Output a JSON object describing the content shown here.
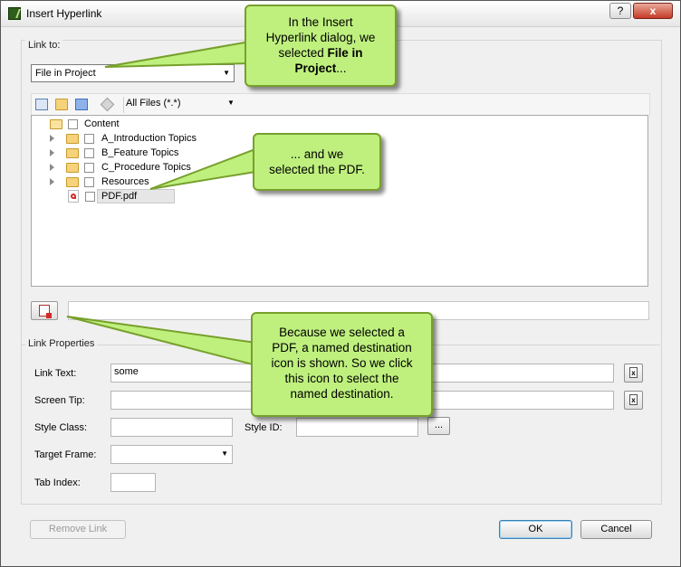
{
  "window": {
    "title": "Insert Hyperlink",
    "help_label": "?",
    "close_label": "x"
  },
  "link_to": {
    "label": "Link to:",
    "selected": "File in Project"
  },
  "toolbar": {
    "filter": "All Files (*.*)"
  },
  "tree": {
    "root": "Content",
    "items": [
      {
        "label": "A_Introduction Topics"
      },
      {
        "label": "B_Feature Topics"
      },
      {
        "label": "C_Procedure Topics"
      },
      {
        "label": "Resources"
      }
    ],
    "file": "PDF.pdf"
  },
  "path_field": {
    "value": ""
  },
  "link_properties": {
    "label": "Link Properties",
    "link_text_label": "Link Text:",
    "link_text_value": "some",
    "screen_tip_label": "Screen Tip:",
    "screen_tip_value": "",
    "style_class_label": "Style Class:",
    "style_id_label": "Style ID:",
    "target_frame_label": "Target Frame:",
    "target_frame_value": "",
    "tab_index_label": "Tab Index:",
    "ellipsis_label": "..."
  },
  "buttons": {
    "remove_link": "Remove Link",
    "ok": "OK",
    "cancel": "Cancel"
  },
  "callouts": {
    "first": {
      "line1": "In the Insert",
      "line2": "Hyperlink dialog, we",
      "line3": "selected ",
      "bold1": "File in",
      "bold2": "Project",
      "tail": "..."
    },
    "second": {
      "line1": "... and we",
      "line2": "selected the PDF."
    },
    "third": {
      "line1": "Because we selected a",
      "line2": "PDF, a named destination",
      "line3": "icon is shown. So we click",
      "line4": "this icon to select the",
      "line5": "named destination."
    }
  },
  "colors": {
    "callout_fill": "#bff07e",
    "callout_border": "#77a02c"
  },
  "icons": {
    "app": "app-icon",
    "named_destination": "named-destination-icon",
    "pdf": "pdf-icon",
    "folder": "folder-icon",
    "clear": "clear-icon"
  }
}
